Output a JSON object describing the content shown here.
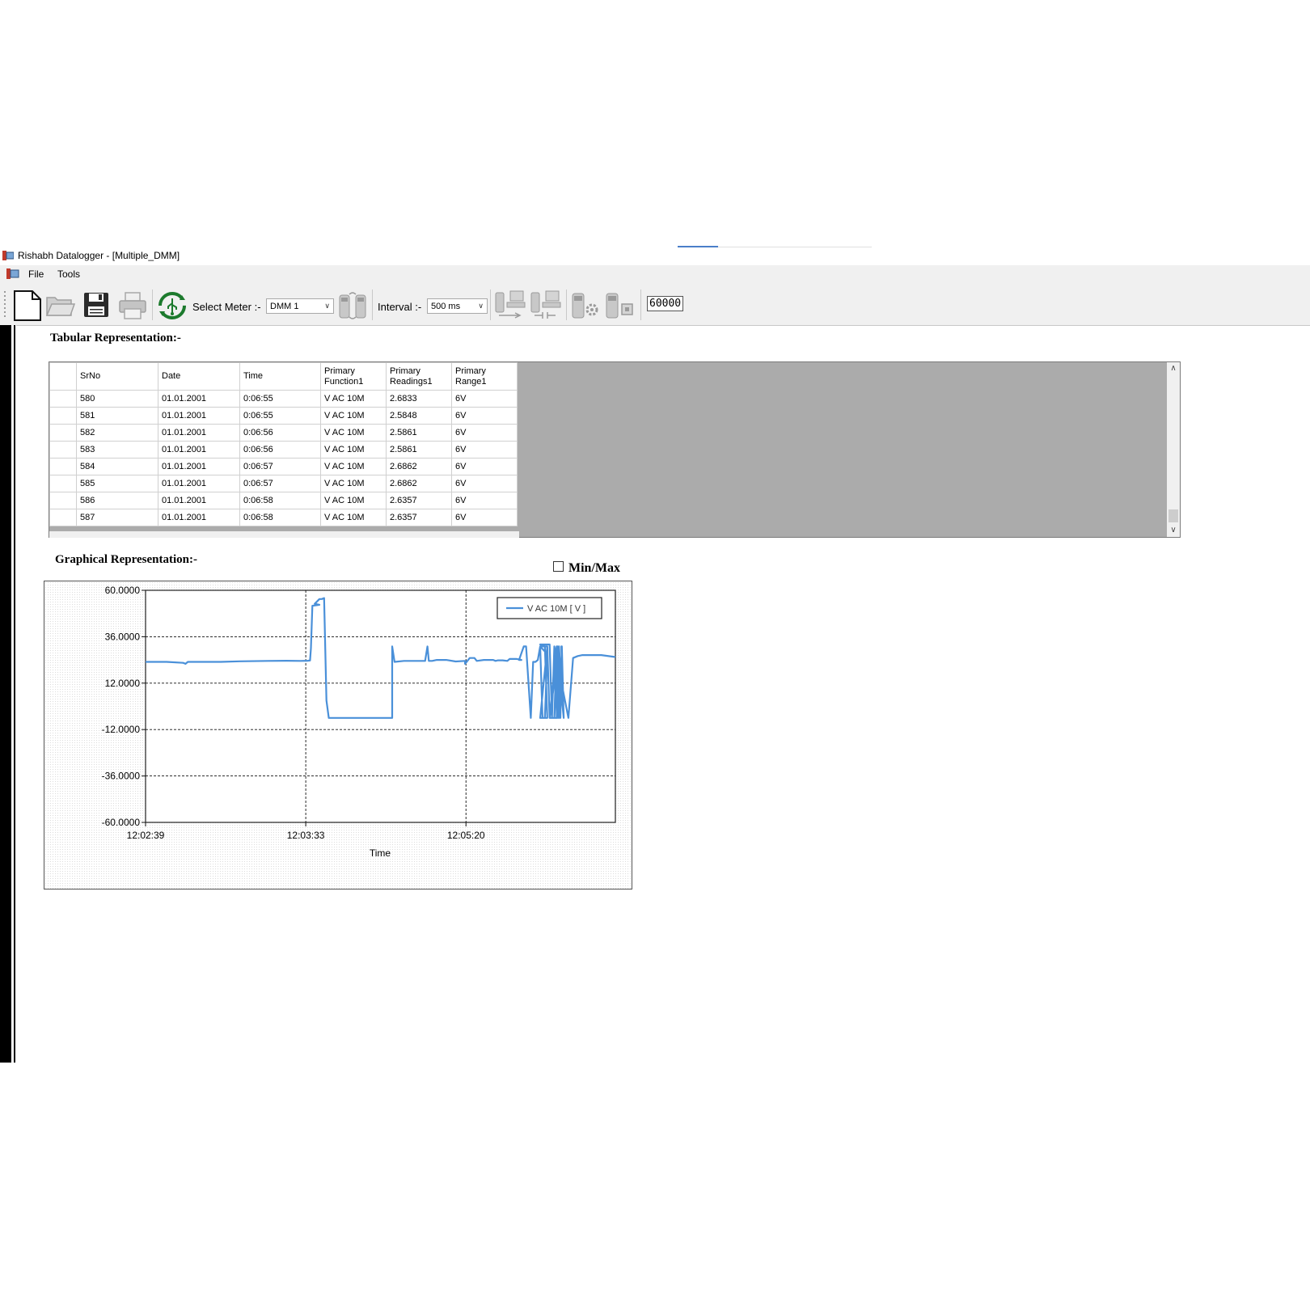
{
  "window": {
    "title": "Rishabh Datalogger - [Multiple_DMM]"
  },
  "menu": [
    "File",
    "Tools"
  ],
  "toolbar": {
    "select_meter_label": "Select Meter :-",
    "select_meter_value": "DMM 1",
    "interval_label": "Interval :-",
    "interval_value": "500 ms",
    "counter": "60000"
  },
  "tabular": {
    "title": "Tabular Representation:-",
    "columns": [
      "SrNo",
      "Date",
      "Time",
      "Primary\nFunction1",
      "Primary\nReadings1",
      "Primary\nRange1"
    ],
    "rows": [
      [
        "580",
        "01.01.2001",
        "0:06:55",
        "V AC 10M",
        "2.6833",
        "6V"
      ],
      [
        "581",
        "01.01.2001",
        "0:06:55",
        "V AC 10M",
        "2.5848",
        "6V"
      ],
      [
        "582",
        "01.01.2001",
        "0:06:56",
        "V AC 10M",
        "2.5861",
        "6V"
      ],
      [
        "583",
        "01.01.2001",
        "0:06:56",
        "V AC 10M",
        "2.5861",
        "6V"
      ],
      [
        "584",
        "01.01.2001",
        "0:06:57",
        "V AC 10M",
        "2.6862",
        "6V"
      ],
      [
        "585",
        "01.01.2001",
        "0:06:57",
        "V AC 10M",
        "2.6862",
        "6V"
      ],
      [
        "586",
        "01.01.2001",
        "0:06:58",
        "V AC 10M",
        "2.6357",
        "6V"
      ],
      [
        "587",
        "01.01.2001",
        "0:06:58",
        "V AC 10M",
        "2.6357",
        "6V"
      ]
    ]
  },
  "graph": {
    "title": "Graphical Representation:-",
    "minmax_label": "Min/Max",
    "minmax_checked": false
  },
  "chart_data": {
    "type": "line",
    "xlabel": "Time",
    "ylabel": "",
    "ylim": [
      -60,
      60
    ],
    "yticks": [
      "60.0000",
      "36.0000",
      "12.0000",
      "-12.0000",
      "-36.0000",
      "-60.0000"
    ],
    "xticks": [
      "12:02:39",
      "12:03:33",
      "12:05:20"
    ],
    "grid": true,
    "legend_position": "top-right",
    "series_color": "#4a90d9",
    "series": [
      {
        "name": "V AC 10M [ V ]",
        "x": [
          0,
          0.045,
          0.08,
          0.085,
          0.09,
          0.16,
          0.2,
          0.26,
          0.3,
          0.33,
          0.345,
          0.35,
          0.352,
          0.355,
          0.37,
          0.36,
          0.37,
          0.375,
          0.38,
          0.385,
          0.39,
          0.5,
          0.525,
          0.525,
          0.53,
          0.55,
          0.595,
          0.6,
          0.603,
          0.61,
          0.62,
          0.64,
          0.66,
          0.68,
          0.68,
          0.69,
          0.7,
          0.705,
          0.72,
          0.74,
          0.745,
          0.75,
          0.76,
          0.77,
          0.775,
          0.79,
          0.8,
          0.795,
          0.805,
          0.81,
          0.82,
          0.825,
          0.83,
          0.835,
          0.84,
          0.845,
          0.85,
          0.855,
          0.84,
          0.855,
          0.84,
          0.855,
          0.85,
          0.84,
          0.86,
          0.865,
          0.87,
          0.875,
          0.877,
          0.88,
          0.88,
          0.86,
          0.88,
          0.875,
          0.88,
          0.87,
          0.88,
          0.876,
          0.88,
          0.87,
          0.875,
          0.878,
          0.88,
          0.883,
          0.886,
          0.89,
          0.885,
          0.89,
          0.88,
          0.89,
          0.875,
          0.86,
          0.855,
          0.86,
          0.865,
          0.87,
          0.9,
          0.91,
          0.92,
          0.93,
          0.95,
          0.97,
          1.0
        ],
        "y": [
          23,
          23,
          22.5,
          22,
          23,
          23,
          23.3,
          23.5,
          23.6,
          23.5,
          23.6,
          23.7,
          30,
          52,
          52.5,
          53,
          55.5,
          55.5,
          56,
          3,
          -6,
          -6,
          -6,
          31,
          23,
          23.5,
          23.5,
          31,
          23.5,
          23.5,
          24,
          24,
          23.2,
          23.5,
          22,
          25,
          25,
          23.5,
          24,
          24,
          23.5,
          23.8,
          23.8,
          23.5,
          24.5,
          24.5,
          24,
          24,
          31,
          31,
          -6,
          23,
          23,
          24,
          31,
          -6,
          -6,
          27,
          31,
          31,
          -6,
          -6,
          31,
          32,
          32,
          -6,
          -6,
          -6,
          31,
          -6,
          31,
          -6,
          31,
          -6,
          31,
          -6,
          31,
          -6,
          31,
          -6,
          31,
          -6,
          31,
          -6,
          31,
          -6,
          31,
          -6,
          31,
          -6,
          31,
          -6,
          31,
          -6,
          -6,
          31,
          -6,
          25,
          26,
          26.5,
          26.5,
          26.5,
          25.5
        ]
      }
    ]
  }
}
